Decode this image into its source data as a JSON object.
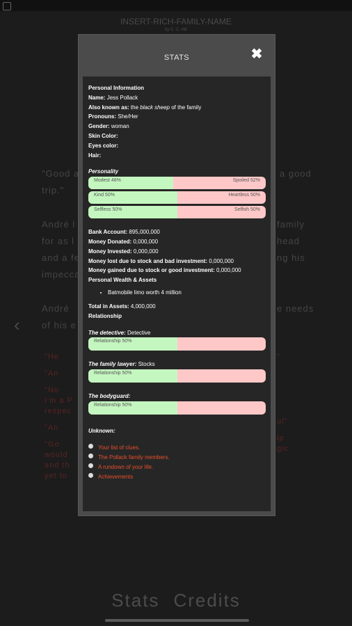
{
  "background": {
    "book_title": "INSERT-RICH-FAMILY-NAME",
    "book_author": "by C. C. Hill",
    "para1_line1": "\"Good a",
    "para1_line1_end": "a good",
    "para1_line2": "trip.\"",
    "para2_l1": "André l",
    "para2_l1_end": "family",
    "para2_l2": "for as l",
    "para2_l2_end": "head",
    "para2_l3": "and a fe",
    "para2_l3_end": "ng his",
    "para2_l4": "impecca",
    "para3_l1": "André",
    "para3_l1_end": "e needs",
    "para3_l2": "of his e",
    "choice1": "\"He",
    "choice2": "\"An",
    "choice3a": "\"No",
    "choice3b": "I'm a P",
    "choice3c": "respec",
    "choice4": "\"An",
    "choice5a": "\"Go",
    "choice5b": "would",
    "choice5c": "and th",
    "choice5d": "yet to",
    "r1": "\"",
    "r4": "ul\"",
    "r5a": "ip",
    "r5b": "gic",
    "nav_stats": "Stats",
    "nav_credits": "Credits"
  },
  "modal": {
    "title": "STATS",
    "personal_heading": "Personal Information",
    "name_label": "Name:",
    "name_value": "Jess Pollack",
    "aka_label": "Also known as:",
    "aka_pre": "the",
    "aka_italic": "black sheep",
    "aka_post": "of the family",
    "pronouns_label": "Pronouns:",
    "pronouns_value": "She/Her",
    "gender_label": "Gender:",
    "gender_value": "woman",
    "skin_label": "Skin Color:",
    "eyes_label": "Eyes color:",
    "hair_label": "Hair:",
    "personality_heading": "Personality",
    "personality_bars": [
      {
        "left": "Modest 48%",
        "right": "Spoiled 52%",
        "value": 48
      },
      {
        "left": "Kind 50%",
        "right": "Heartless 50%",
        "value": 50
      },
      {
        "left": "Selfless 50%",
        "right": "Selfish 50%",
        "value": 50
      }
    ],
    "bank_label": "Bank Account:",
    "bank_value": "895,000,000",
    "donated_label": "Money Donated:",
    "donated_value": "0,000,000",
    "invested_label": "Money Invested:",
    "invested_value": "0,000,000",
    "lost_label": "Money lost due to stock and bad investment:",
    "lost_value": "0,000,000",
    "gained_label": "Money gained due to stock or good investment:",
    "gained_value": "0,000,000",
    "wealth_heading": "Personal Wealth & Assets",
    "asset_item": "Batmobile limo worth 4 million",
    "total_label": "Total in Assets:",
    "total_value": "4,000,000",
    "relationship_heading": "Relationship",
    "relationships": [
      {
        "title": "The detective:",
        "name": "Detective",
        "bar_label": "Relationship 50%",
        "value": 50
      },
      {
        "title": "The family lawyer:",
        "name": "Stocks",
        "bar_label": "Relationship 50%",
        "value": 50
      },
      {
        "title": "The bodyguard:",
        "name": "",
        "bar_label": "Relationship 50%",
        "value": 50
      }
    ],
    "unknown_heading": "Unknown:",
    "links": [
      "Your list of clues.",
      "The Pollack family members.",
      "A rundown of your life.",
      "Achievements"
    ]
  },
  "colors": {
    "link": "#e8502a",
    "bar_positive": "#c4f7c0",
    "bar_negative": "#ffc8c8"
  }
}
